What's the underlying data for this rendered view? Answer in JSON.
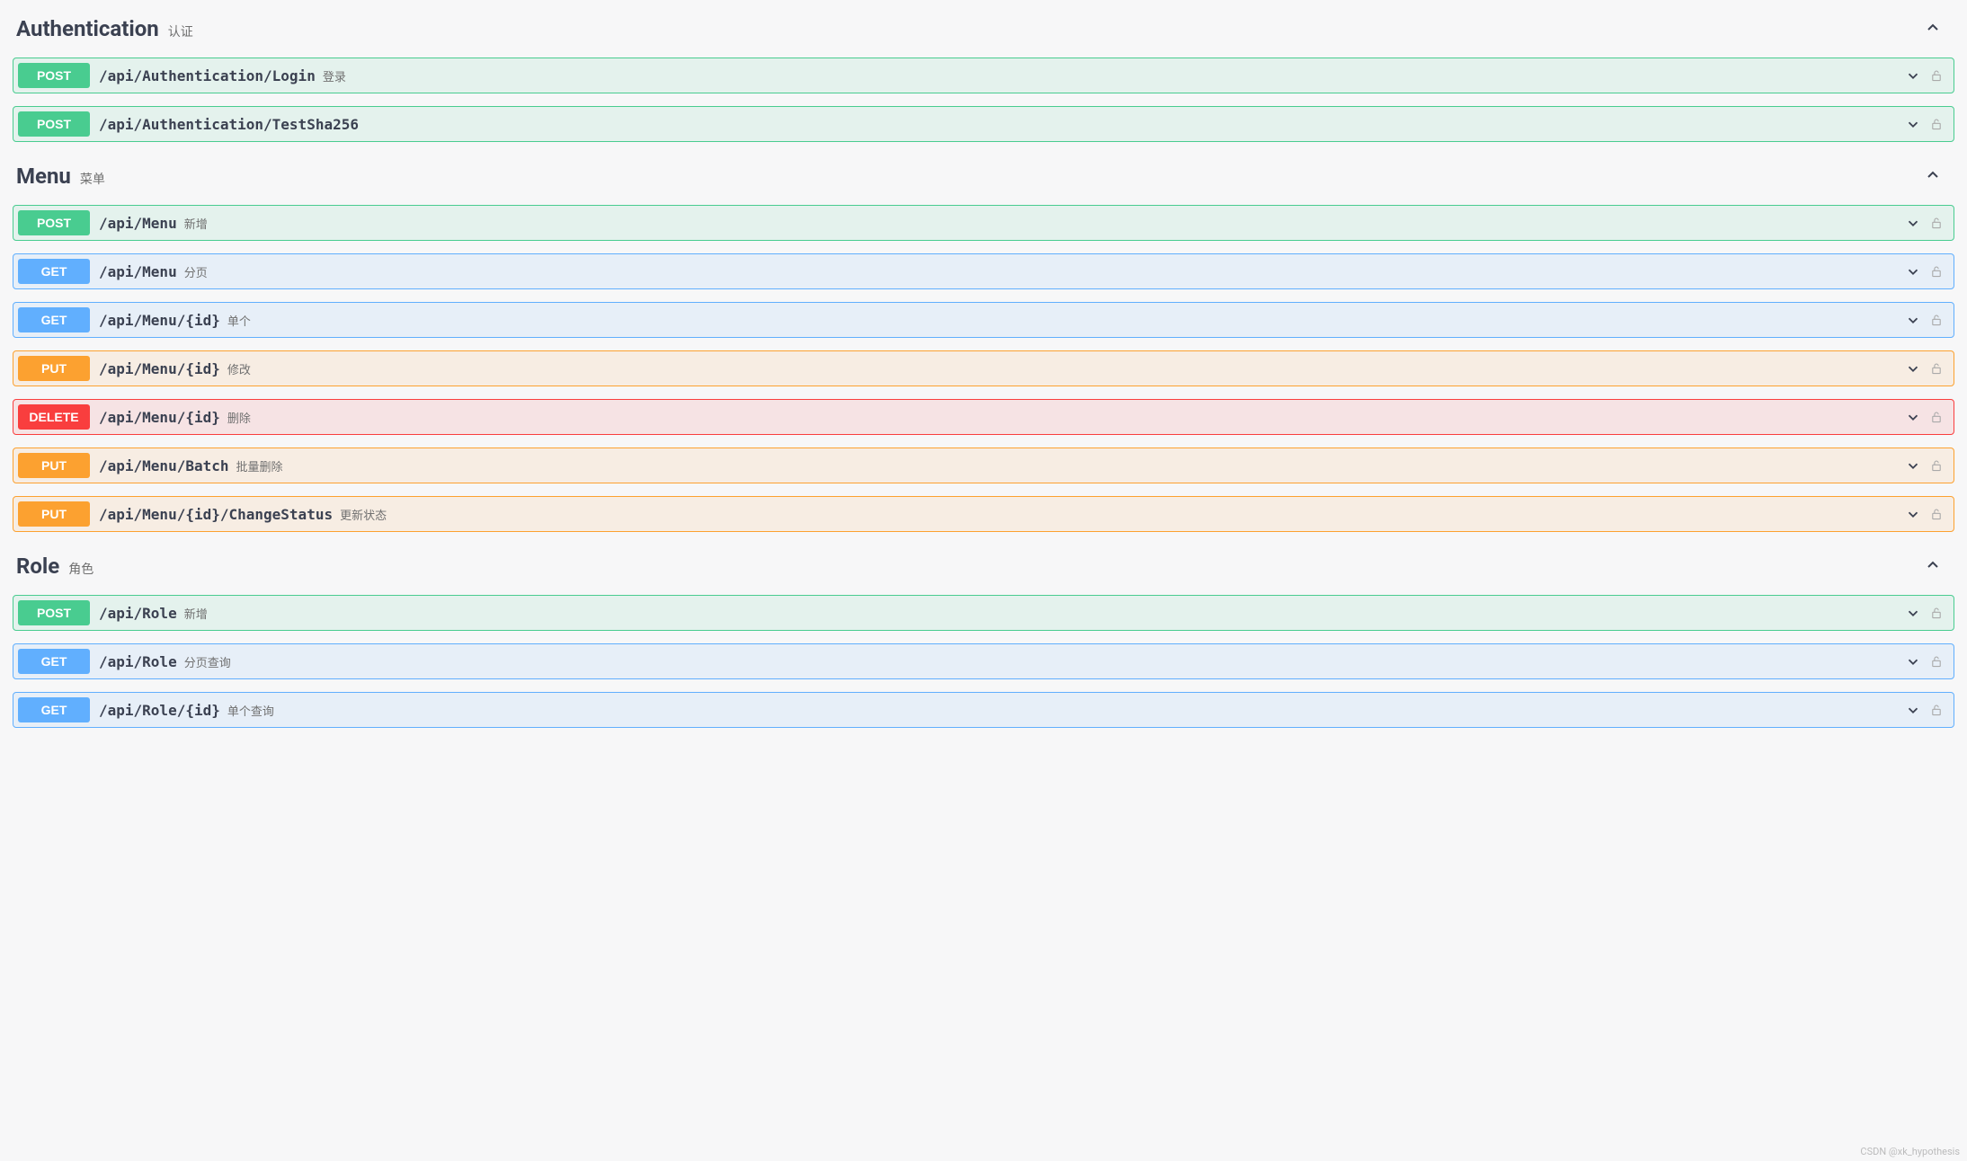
{
  "watermark": "CSDN @xk_hypothesis",
  "methodStyles": {
    "POST": "post",
    "GET": "get",
    "PUT": "put",
    "DELETE": "delete"
  },
  "sections": [
    {
      "title": "Authentication",
      "desc": "认证",
      "endpoints": [
        {
          "method": "POST",
          "path": "/api/Authentication/Login",
          "desc": "登录"
        },
        {
          "method": "POST",
          "path": "/api/Authentication/TestSha256",
          "desc": ""
        }
      ]
    },
    {
      "title": "Menu",
      "desc": "菜单",
      "endpoints": [
        {
          "method": "POST",
          "path": "/api/Menu",
          "desc": "新增"
        },
        {
          "method": "GET",
          "path": "/api/Menu",
          "desc": "分页"
        },
        {
          "method": "GET",
          "path": "/api/Menu/{id}",
          "desc": "单个"
        },
        {
          "method": "PUT",
          "path": "/api/Menu/{id}",
          "desc": "修改"
        },
        {
          "method": "DELETE",
          "path": "/api/Menu/{id}",
          "desc": "删除"
        },
        {
          "method": "PUT",
          "path": "/api/Menu/Batch",
          "desc": "批量删除"
        },
        {
          "method": "PUT",
          "path": "/api/Menu/{id}/ChangeStatus",
          "desc": "更新状态"
        }
      ]
    },
    {
      "title": "Role",
      "desc": "角色",
      "endpoints": [
        {
          "method": "POST",
          "path": "/api/Role",
          "desc": "新增"
        },
        {
          "method": "GET",
          "path": "/api/Role",
          "desc": "分页查询"
        },
        {
          "method": "GET",
          "path": "/api/Role/{id}",
          "desc": "单个查询"
        }
      ]
    }
  ]
}
